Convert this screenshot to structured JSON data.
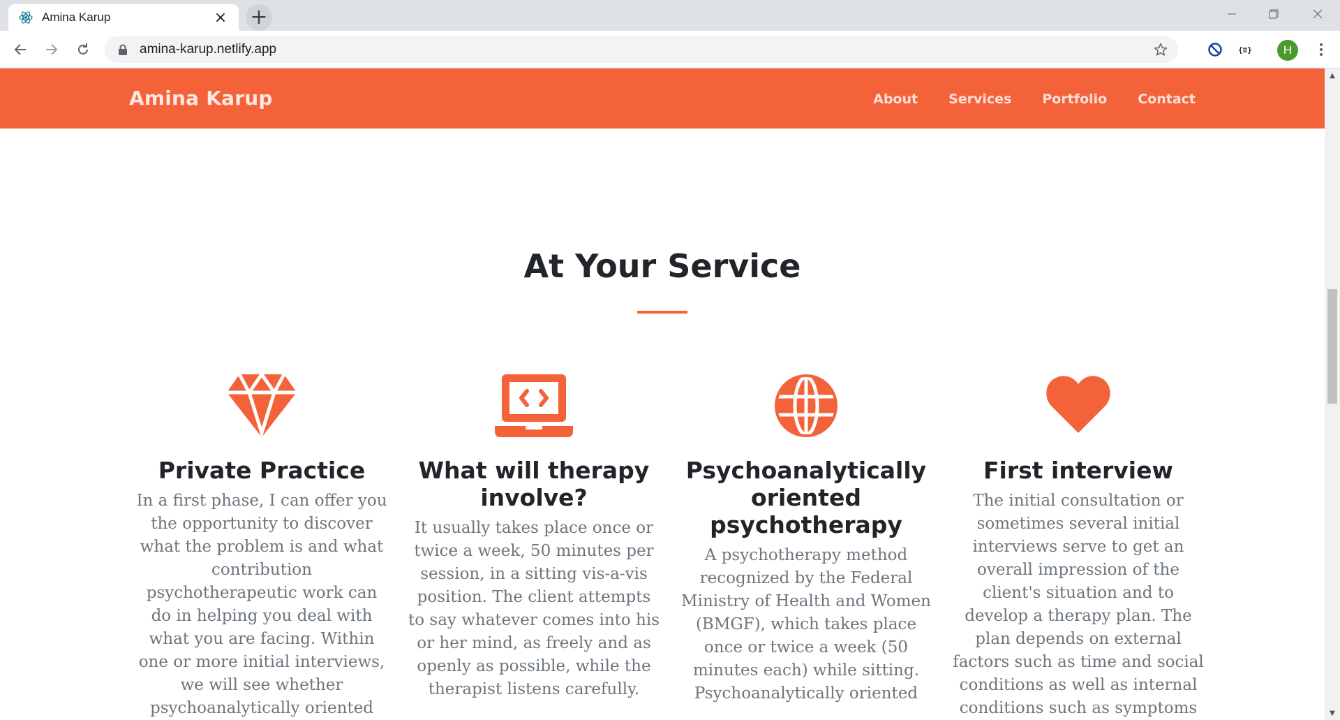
{
  "browser": {
    "tab_title": "Amina Karup",
    "url": "amina-karup.netlify.app",
    "profile_initial": "H"
  },
  "site": {
    "brand": "Amina Karup",
    "accent_color": "#f4623a",
    "nav": [
      {
        "label": "About"
      },
      {
        "label": "Services"
      },
      {
        "label": "Portfolio"
      },
      {
        "label": "Contact"
      }
    ]
  },
  "section": {
    "title": "At Your Service",
    "services": [
      {
        "icon": "gem-icon",
        "title": "Private Practice",
        "text": "In a first phase, I can offer you the opportunity to discover what the problem is and what contribution psychotherapeutic work can do in helping you deal with what you are facing. Within one or more initial interviews, we will see whether psychoanalytically oriented psychotherapy is the right"
      },
      {
        "icon": "laptop-code-icon",
        "title": "What will therapy involve?",
        "text": "It usually takes place once or twice a week, 50 minutes per session, in a sitting vis-a-vis position. The client attempts to say whatever comes into his or her mind, as freely and as openly as possible, while the therapist listens carefully."
      },
      {
        "icon": "globe-icon",
        "title": "Psychoanalytically oriented psychotherapy",
        "text": "A psychotherapy method recognized by the Federal Ministry of Health and Women (BMGF), which takes place once or twice a week (50 minutes each) while sitting. Psychoanalytically oriented"
      },
      {
        "icon": "heart-icon",
        "title": "First interview",
        "text": "The initial consultation or sometimes several initial interviews serve to get an overall impression of the client's situation and to develop a therapy plan. The plan depends on external factors such as time and social conditions as well as internal conditions such as symptoms"
      }
    ]
  }
}
